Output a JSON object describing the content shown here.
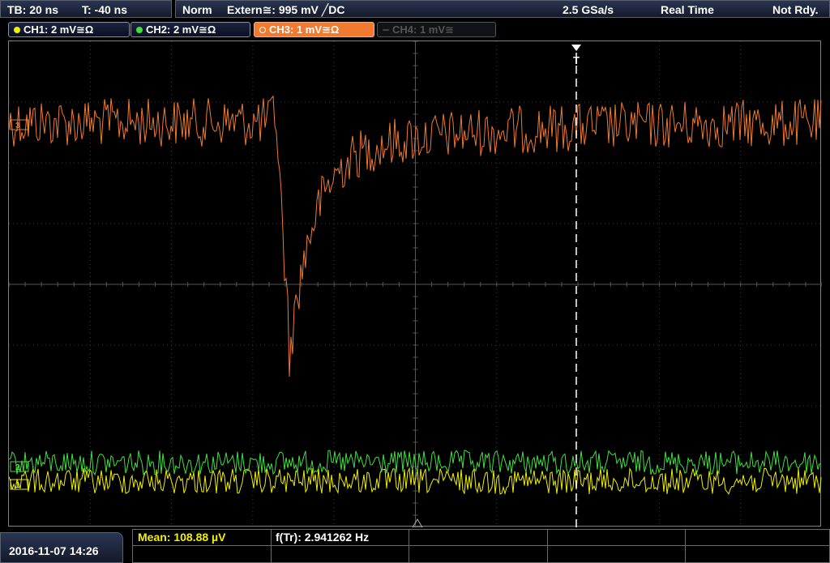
{
  "topbar": {
    "timebase": "TB: 20 ns",
    "trigger_offset": "T: -40 ns",
    "mode": "Norm",
    "trigger_source": "Extern≅: 995 mV ╱DC",
    "sample_rate": "2.5 GSa/s",
    "acq_mode": "Real Time",
    "status": "Not Rdy."
  },
  "channels": [
    {
      "label": "CH1: 2 mV≅Ω",
      "color": "#f0f000",
      "state": "on"
    },
    {
      "label": "CH2: 2 mV≅Ω",
      "color": "#40e040",
      "state": "on"
    },
    {
      "label": "CH3: 1 mV≅Ω",
      "color": "#f07a30",
      "state": "active"
    },
    {
      "label": "CH4: 1 mV≅",
      "color": "#555555",
      "state": "off"
    }
  ],
  "markers": {
    "ch3_marker": "3",
    "ch2_marker": "2",
    "ch1_marker": "1",
    "trigger_marker": "T"
  },
  "bottombar": {
    "datetime": "2016-11-07 14:26",
    "mean": "Mean: 108.88 µV",
    "freq": "f(Tr): 2.941262 Hz"
  }
}
